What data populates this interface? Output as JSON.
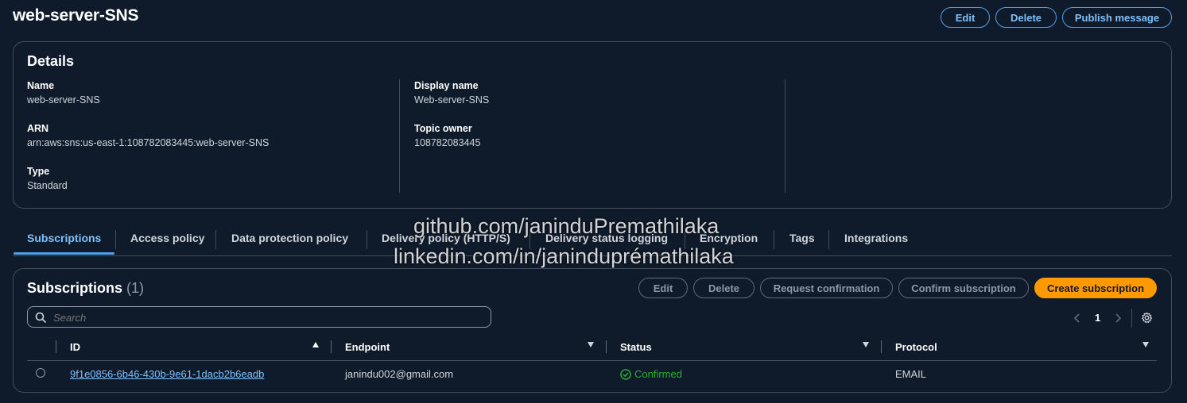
{
  "header": {
    "title": "web-server-SNS",
    "edit_label": "Edit",
    "delete_label": "Delete",
    "publish_label": "Publish message"
  },
  "details": {
    "title": "Details",
    "name_label": "Name",
    "name_value": "web-server-SNS",
    "arn_label": "ARN",
    "arn_value": "arn:aws:sns:us-east-1:108782083445:web-server-SNS",
    "type_label": "Type",
    "type_value": "Standard",
    "display_name_label": "Display name",
    "display_name_value": "Web-server-SNS",
    "topic_owner_label": "Topic owner",
    "topic_owner_value": "108782083445"
  },
  "tabs": [
    {
      "label": "Subscriptions",
      "active": true
    },
    {
      "label": "Access policy"
    },
    {
      "label": "Data protection policy"
    },
    {
      "label": "Delivery policy (HTTP/S)"
    },
    {
      "label": "Delivery status logging"
    },
    {
      "label": "Encryption"
    },
    {
      "label": "Tags"
    },
    {
      "label": "Integrations"
    }
  ],
  "watermark": {
    "line1": "github.com/janinduPremathilaka",
    "line2": "linkedin.com/in/janinduprémathilaka"
  },
  "subscriptions": {
    "title": "Subscriptions",
    "count": "(1)",
    "edit_label": "Edit",
    "delete_label": "Delete",
    "request_label": "Request confirmation",
    "confirm_label": "Confirm subscription",
    "create_label": "Create subscription",
    "search_placeholder": "Search",
    "page": "1",
    "columns": {
      "id": "ID",
      "endpoint": "Endpoint",
      "status": "Status",
      "protocol": "Protocol"
    },
    "rows": [
      {
        "id": "9f1e0856-6b46-430b-9e61-1dacb2b6eadb",
        "endpoint": "janindu002@gmail.com",
        "status": "Confirmed",
        "protocol": "EMAIL"
      }
    ]
  },
  "colors": {
    "accent": "#539fe5",
    "primary": "#ff9900",
    "success": "#29ad32",
    "background": "#0f1b2a"
  }
}
